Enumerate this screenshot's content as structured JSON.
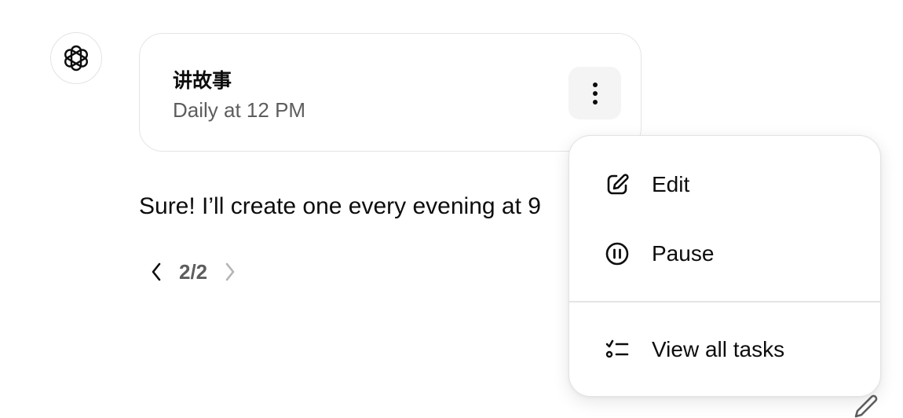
{
  "assistant": {
    "avatar_icon": "openai-logo-icon"
  },
  "task_card": {
    "title": "讲故事",
    "schedule": "Daily at 12 PM",
    "more_icon": "vertical-dots-icon"
  },
  "message": {
    "text": "Sure! I’ll create one every evening at 9"
  },
  "pager": {
    "count": "2/2",
    "prev_icon": "chevron-left-icon",
    "next_icon": "chevron-right-icon"
  },
  "menu": {
    "items": [
      {
        "label": "Edit",
        "icon": "edit-icon"
      },
      {
        "label": "Pause",
        "icon": "pause-icon"
      },
      {
        "label": "View all tasks",
        "icon": "task-list-icon"
      }
    ]
  },
  "colors": {
    "text_primary": "#0d0d0d",
    "text_secondary": "#5d5d5d",
    "border": "#e5e5e5",
    "button_bg": "#f4f4f4"
  }
}
